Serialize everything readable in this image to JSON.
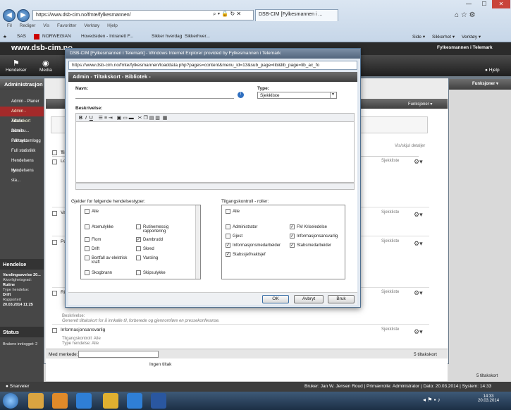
{
  "browser": {
    "address": "https://www.dsb-cim.no/fmte/fylkesmannen/",
    "tab_label": "DSB-CIM [Fylkesmannen i ...",
    "menu": [
      "Fil",
      "Rediger",
      "Vis",
      "Favoritter",
      "Verktøy",
      "Hjelp"
    ],
    "favorites": [
      "SAS",
      "NORWEGIAN",
      "Hovedsiden - Intranett F...",
      "Sikker hverdag",
      "Sikker hverdag",
      "Sikkerhver..."
    ],
    "command_items": [
      "Side ▾",
      "Sikkerhet ▾",
      "Verktøy ▾"
    ]
  },
  "app": {
    "logo": "www.dsb-cim.no",
    "org": "Fylkesmannen i Telemark",
    "toolbar": {
      "hendelser": "Hendelser",
      "media": "Media",
      "hjelp": "Hjelp"
    },
    "admin_header": "Administrasjon",
    "functions": "Funksjoner ▾"
  },
  "sidebar": {
    "items": [
      "Admin - Planer",
      "Admin - Tiltakskort",
      "Admin - Distribu...",
      "Admin - Infotavl...",
      "Full systemlogg",
      "Full statistikk",
      "Hendelsens sys...",
      "Hendelsens sta..."
    ],
    "hendelse_head": "Hendelse",
    "hendelse_lines": [
      "Varslingsøvelse 20...",
      "Alvorlighetsgrad:",
      "Rutine",
      "Type hendelse:",
      "Drift",
      "Rapportert",
      "20.03.2014 11:25"
    ],
    "status_head": "Status",
    "status_line": "Brukere innlogget: 2"
  },
  "main": {
    "list_header": "Tilt",
    "visning": "Vis/skjul detaljer",
    "rows": [
      {
        "title": "Lo",
        "type": "Sjekkliste"
      },
      {
        "title": "Va",
        "type": "Sjekkliste"
      },
      {
        "title": "Pu",
        "type": "Sjekkliste"
      },
      {
        "title": "Ri",
        "type": "Sjekkliste"
      },
      {
        "title": "",
        "type": "Sjekkliste"
      },
      {
        "title": "Informasjonsansvarlig",
        "type": "Sjekkliste"
      }
    ],
    "beskrivelse_label": "Beskrivelse:",
    "beskrivelse_text": "Generelt tiltakskort for å innkalle til, forberede og gjennomføre en pressekonferanse.",
    "info_row": {
      "title": "Informasjonsansvarlig",
      "tilgang": "Tilgangskontroll: Alle",
      "type": "Type hendelse: Alle"
    },
    "med_merkede": "Med merkede:",
    "count": "5 tiltakskort",
    "ingen": "Ingen tiltak",
    "count2": "5 tiltakskort"
  },
  "modal": {
    "title": "DSB-CIM [Fylkesmannen i Telemark] - Windows Internet Explorer provided by Fylkesmannen i Telemark",
    "url": "https://www.dsb-cim.no/fmte/fylkesmannen/loaddata.php?pages=content&menu_id=13&sub_page=lib&lib_page=lib_ac_fo",
    "header": "Admin - Tiltakskort - Bibliotek -",
    "navn_label": "Navn:",
    "type_label": "Type:",
    "type_value": "Sjekkliste",
    "beskrivelse_label": "Beskrivelse:",
    "gjelder_label": "Gjelder for følgende hendelsestyper:",
    "tilgang_label": "Tilgangskontroll - roller:",
    "events_left": [
      {
        "label": "Alle",
        "checked": false
      },
      {
        "label": "Atomulykke",
        "checked": false
      },
      {
        "label": "Flom",
        "checked": false
      },
      {
        "label": "Drift",
        "checked": false
      },
      {
        "label": "Bortfall av elektrisk kraft",
        "checked": false
      },
      {
        "label": "Skogbrann",
        "checked": false
      }
    ],
    "events_right": [
      {
        "label": "Rutinemessig rapportering",
        "checked": false
      },
      {
        "label": "Dambrudd",
        "checked": true
      },
      {
        "label": "Skred",
        "checked": false
      },
      {
        "label": "Varsling",
        "checked": false
      },
      {
        "label": "Skipsulykke",
        "checked": false
      }
    ],
    "roles_left": [
      {
        "label": "Alle",
        "checked": false
      },
      {
        "label": "Administrator",
        "checked": false
      },
      {
        "label": "Gjest",
        "checked": false
      },
      {
        "label": "Informasjonsmedarbeider",
        "checked": true
      },
      {
        "label": "Stabssjef/vaktsjef",
        "checked": true
      }
    ],
    "roles_right": [
      {
        "label": "FM Kriseledelse",
        "checked": true
      },
      {
        "label": "Informasjonsansvarlig",
        "checked": true
      },
      {
        "label": "Stabsmedarbeider",
        "checked": true
      }
    ],
    "ok": "OK",
    "avbryt": "Avbryt",
    "bruk": "Bruk"
  },
  "statusbar": {
    "user_text": "Bruker: Jan W. Jensen Roud | Primærrolle: Administrator | Dato: 20.03.2014 | System: 14:33",
    "snarveier": "Snarveier"
  },
  "taskbar": {
    "time": "14:33",
    "date": "20.03.2014"
  }
}
